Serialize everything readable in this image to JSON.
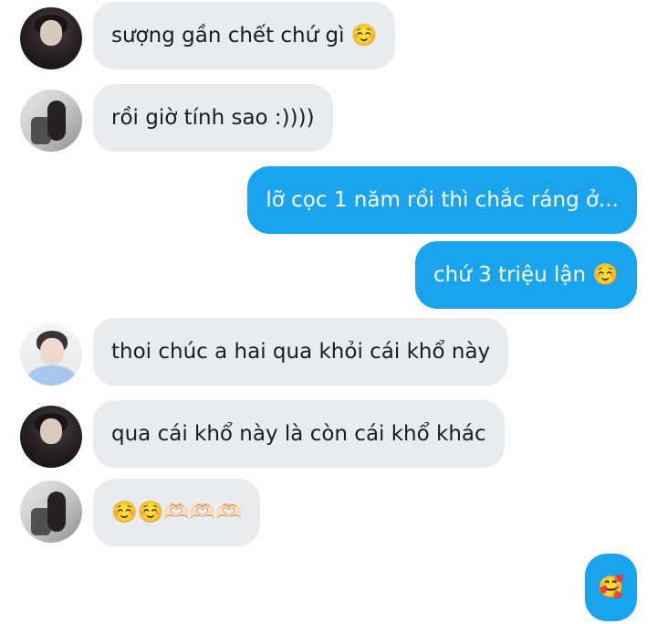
{
  "messages": [
    {
      "sender": "them",
      "avatar": "avatar-dark-hoodie",
      "text": "sượng gần chết chứ gì ☺️"
    },
    {
      "sender": "them",
      "avatar": "avatar-photo-room",
      "text": "rồi giờ tính sao :))))"
    },
    {
      "sender": "me",
      "text": "lỡ cọc 1 năm rồi thì chắc ráng ở..."
    },
    {
      "sender": "me",
      "text": "chứ 3 triệu lận ☺️"
    },
    {
      "sender": "them",
      "avatar": "avatar-light-shirt",
      "text": "thoi chúc a hai qua khỏi cái khổ này"
    },
    {
      "sender": "them",
      "avatar": "avatar-dark-hoodie",
      "text": "qua cái khổ này là còn cái khổ khác"
    },
    {
      "sender": "them",
      "avatar": "avatar-photo-room",
      "text": "☺️☺️🫶🏻🫶🏻🫶🏻"
    },
    {
      "sender": "me",
      "text": "🥰"
    }
  ],
  "colors": {
    "incoming_bubble": "#e9ecef",
    "outgoing_bubble": "#1ba4ee"
  }
}
